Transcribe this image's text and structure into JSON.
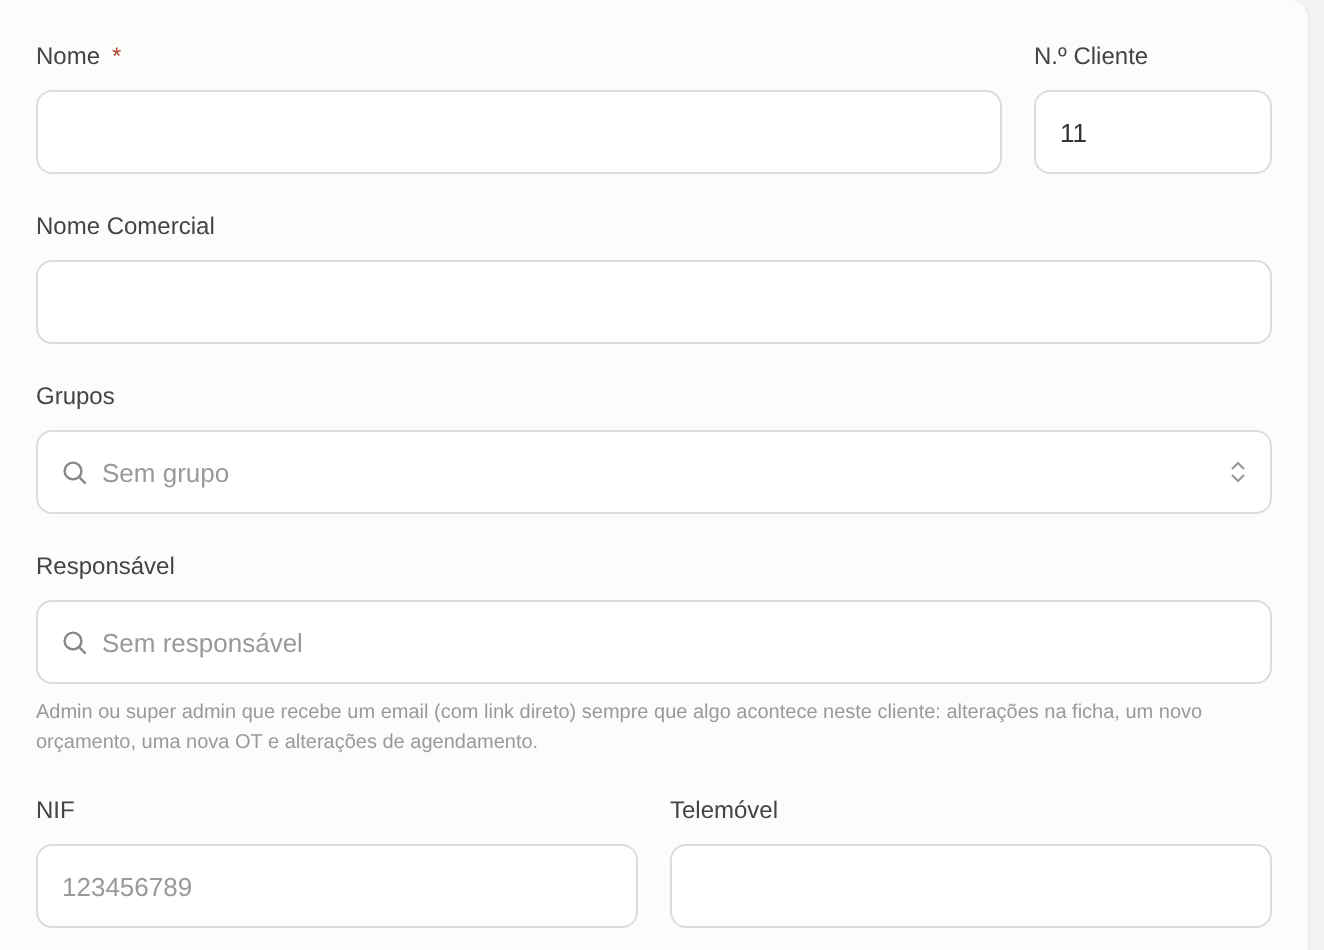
{
  "name": {
    "label": "Nome",
    "required_mark": "*"
  },
  "client_number": {
    "label": "N.º Cliente",
    "value": "11"
  },
  "trade_name": {
    "label": "Nome Comercial"
  },
  "groups": {
    "label": "Grupos",
    "placeholder": "Sem grupo"
  },
  "manager": {
    "label": "Responsável",
    "placeholder": "Sem responsável",
    "help": "Admin ou super admin que recebe um email (com link direto) sempre que algo acontece neste cliente: alterações na ficha, um novo orçamento, uma nova OT e alterações de agendamento."
  },
  "nif": {
    "label": "NIF",
    "placeholder": "123456789"
  },
  "mobile": {
    "label": "Telemóvel"
  }
}
